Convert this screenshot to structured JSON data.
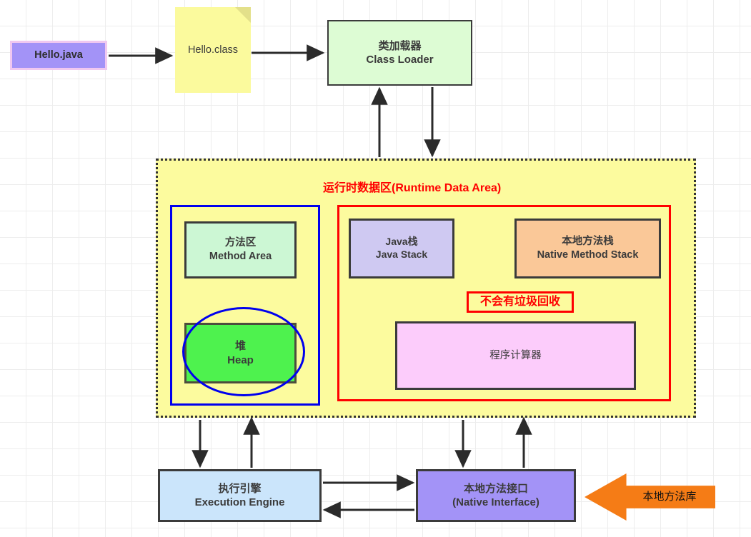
{
  "diagram": {
    "title_visible": false,
    "colors": {
      "runtime_fill": "#fcfb9e",
      "runtime_border": "#333333",
      "accent_red": "#ff0000",
      "accent_blue": "#0000ee",
      "orange": "#f57c16",
      "heap_green": "#4ef24e",
      "method_area_green": "#ccf7d4",
      "java_stack_purple": "#cfc9f2",
      "native_stack_orange": "#fac898",
      "pc_pink": "#fcccfb",
      "exec_engine_blue": "#cbe5fb",
      "native_interface_purple": "#a393f7",
      "class_loader_green": "#ddfcd4",
      "class_file_yellow": "#fbfa9d"
    }
  },
  "nodes": {
    "hello_java": {
      "label": "Hello.java"
    },
    "hello_class": {
      "label": "Hello.class"
    },
    "class_loader": {
      "cn": "类加载器",
      "en": "Class Loader"
    },
    "runtime_area": {
      "title": "运行时数据区(Runtime Data Area)"
    },
    "method_area": {
      "cn": "方法区",
      "en": "Method Area"
    },
    "heap": {
      "cn": "堆",
      "en": "Heap"
    },
    "java_stack": {
      "cn": "Java栈",
      "en": "Java Stack"
    },
    "native_method_stack": {
      "cn": "本地方法栈",
      "en": "Native Method Stack"
    },
    "no_gc_note": {
      "label": "不会有垃圾回收"
    },
    "pc_register": {
      "cn": "程序计算器"
    },
    "execution_engine": {
      "cn": "执行引擎",
      "en": "Execution Engine"
    },
    "native_interface": {
      "cn": "本地方法接口",
      "en": "(Native Interface)"
    },
    "native_library": {
      "label": "本地方法库"
    }
  }
}
